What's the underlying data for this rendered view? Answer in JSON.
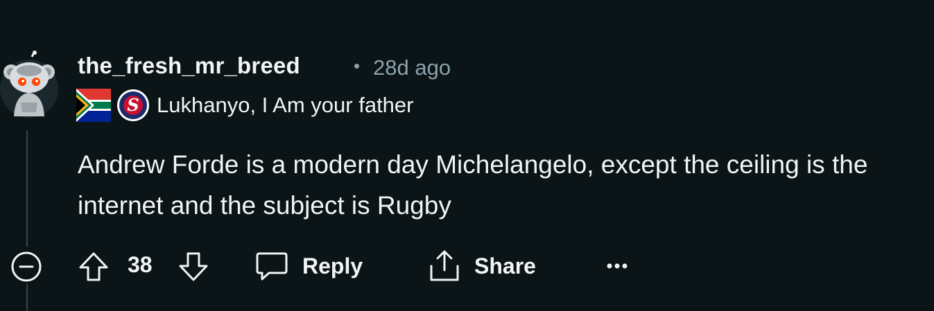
{
  "comment": {
    "username": "the_fresh_mr_breed",
    "separator": "•",
    "timestamp": "28d ago",
    "flair_text": "Lukhanyo, I Am your father",
    "body": "Andrew Forde is a modern day Michelangelo, except the ceiling is the internet and the subject is Rugby",
    "score": "38",
    "reply_label": "Reply",
    "share_label": "Share",
    "more_label": "•••"
  },
  "icons": {
    "avatar": "snoo-avatar-icon",
    "flag": "south-africa-flag-icon",
    "team_logo": "stormers-logo-icon",
    "collapse": "collapse-minus-icon",
    "upvote": "upvote-arrow-icon",
    "downvote": "downvote-arrow-icon",
    "reply": "speech-bubble-icon",
    "share": "share-upload-icon"
  },
  "colors": {
    "background": "#0b1416",
    "text_primary": "#f2f4f5",
    "text_meta": "#8ba2ad",
    "thread_line": "#33464c"
  }
}
